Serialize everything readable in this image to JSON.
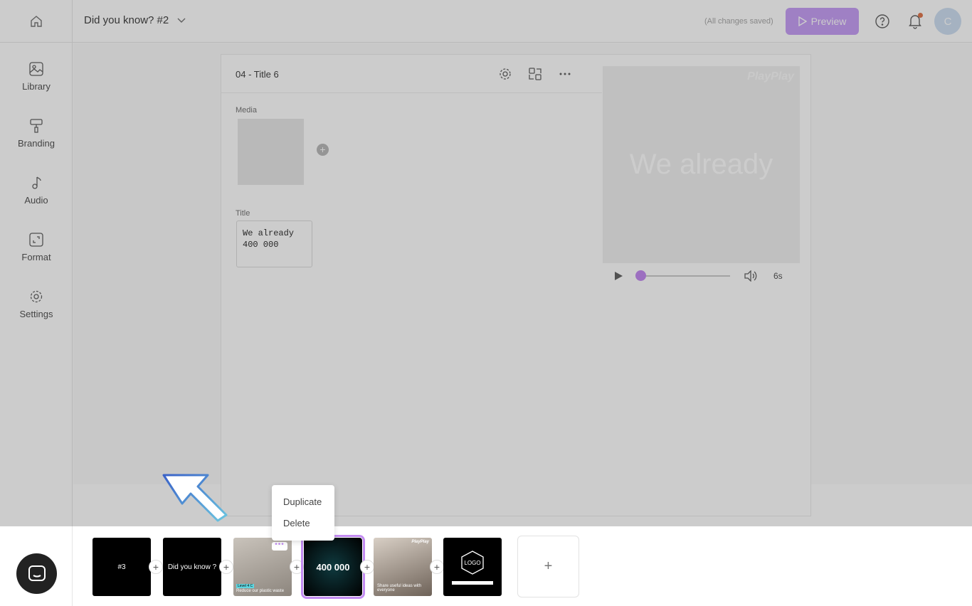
{
  "header": {
    "project_title": "Did you know? #2",
    "save_status": "(All changes saved)",
    "preview_label": "Preview",
    "avatar_initial": "C"
  },
  "sidebar": {
    "items": [
      {
        "label": "Library",
        "icon": "image-icon"
      },
      {
        "label": "Branding",
        "icon": "paint-roller-icon"
      },
      {
        "label": "Audio",
        "icon": "music-note-icon"
      },
      {
        "label": "Format",
        "icon": "format-icon"
      },
      {
        "label": "Settings",
        "icon": "gear-icon"
      }
    ]
  },
  "editor": {
    "slide_title": "04 - Title 6",
    "media_label": "Media",
    "title_label": "Title",
    "title_value": "We already\n400 000"
  },
  "preview": {
    "logo_text": "PlayPlay",
    "text": "We already",
    "duration": "6s",
    "progress": 0
  },
  "timeline": {
    "slides": [
      {
        "text": "#3"
      },
      {
        "text": "Did you know ?"
      },
      {
        "text": "Reduce our plastic waste",
        "badge": "Level 4 C"
      },
      {
        "text": "400 000",
        "selected": true
      },
      {
        "text": "Share useful ideas with everyone",
        "logo_text": "PlayPlay"
      },
      {
        "text": "LOGO"
      }
    ],
    "add_label": "+"
  },
  "context_menu": {
    "items": [
      "Duplicate",
      "Delete"
    ]
  },
  "colors": {
    "accent": "#c38bf1",
    "preview_button": "#c7a0f6",
    "notification_dot": "#e0784f"
  }
}
